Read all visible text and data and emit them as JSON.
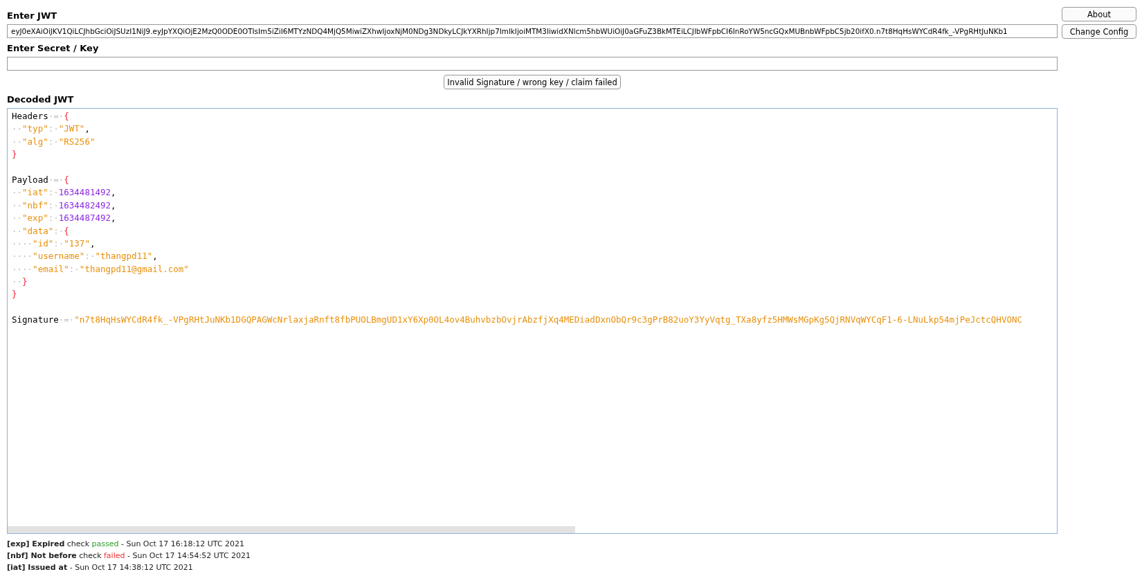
{
  "jwt": {
    "label": "Enter JWT",
    "value": "eyJ0eXAiOiJKV1QiLCJhbGciOiJSUzI1NiJ9.eyJpYXQiOjE2MzQ0ODE0OTIsIm5iZiI6MTYzNDQ4MjQ5MiwiZXhwIjoxNjM0NDg3NDkyLCJkYXRhIjp7ImlkIjoiMTM3IiwidXNlcm5hbWUiOiJ0aGFuZ3BkMTEiLCJlbWFpbCI6InRoYW5ncGQxMUBnbWFpbC5jb20ifX0.n7t8HqHsWYCdR4fk_-VPgRHtJuNKb1"
  },
  "secret": {
    "label": "Enter Secret / Key"
  },
  "verify_button": "Invalid Signature / wrong key / claim failed",
  "side_buttons": [
    "About",
    "Change Config"
  ],
  "decoded": {
    "label": "Decoded JWT",
    "lines": [
      [
        {
          "kind": "plain",
          "text": "Headers"
        },
        {
          "kind": "ws",
          "text": "·=·"
        },
        {
          "kind": "brace",
          "text": "{"
        }
      ],
      [
        {
          "kind": "ws",
          "text": "··"
        },
        {
          "kind": "str",
          "text": "\"typ\""
        },
        {
          "kind": "ws",
          "text": ":·"
        },
        {
          "kind": "str",
          "text": "\"JWT\""
        },
        {
          "kind": "plain",
          "text": ","
        }
      ],
      [
        {
          "kind": "ws",
          "text": "··"
        },
        {
          "kind": "str",
          "text": "\"alg\""
        },
        {
          "kind": "ws",
          "text": ":·"
        },
        {
          "kind": "str",
          "text": "\"RS256\""
        }
      ],
      [
        {
          "kind": "brace",
          "text": "}"
        }
      ],
      [
        {
          "kind": "gap"
        },
        {
          "kind": "plain",
          "text": "Payload"
        },
        {
          "kind": "ws",
          "text": "·=·"
        },
        {
          "kind": "brace",
          "text": "{"
        }
      ],
      [
        {
          "kind": "ws",
          "text": "··"
        },
        {
          "kind": "str",
          "text": "\"iat\""
        },
        {
          "kind": "ws",
          "text": ":·"
        },
        {
          "kind": "num",
          "text": "1634481492"
        },
        {
          "kind": "plain",
          "text": ","
        }
      ],
      [
        {
          "kind": "ws",
          "text": "··"
        },
        {
          "kind": "str",
          "text": "\"nbf\""
        },
        {
          "kind": "ws",
          "text": ":·"
        },
        {
          "kind": "num",
          "text": "1634482492"
        },
        {
          "kind": "plain",
          "text": ","
        }
      ],
      [
        {
          "kind": "ws",
          "text": "··"
        },
        {
          "kind": "str",
          "text": "\"exp\""
        },
        {
          "kind": "ws",
          "text": ":·"
        },
        {
          "kind": "num",
          "text": "1634487492"
        },
        {
          "kind": "plain",
          "text": ","
        }
      ],
      [
        {
          "kind": "ws",
          "text": "··"
        },
        {
          "kind": "str",
          "text": "\"data\""
        },
        {
          "kind": "ws",
          "text": ":·"
        },
        {
          "kind": "brace",
          "text": "{"
        }
      ],
      [
        {
          "kind": "ws",
          "text": "····"
        },
        {
          "kind": "str",
          "text": "\"id\""
        },
        {
          "kind": "ws",
          "text": ":·"
        },
        {
          "kind": "str",
          "text": "\"137\""
        },
        {
          "kind": "plain",
          "text": ","
        }
      ],
      [
        {
          "kind": "ws",
          "text": "····"
        },
        {
          "kind": "str",
          "text": "\"username\""
        },
        {
          "kind": "ws",
          "text": ":·"
        },
        {
          "kind": "str",
          "text": "\"thangpd11\""
        },
        {
          "kind": "plain",
          "text": ","
        }
      ],
      [
        {
          "kind": "ws",
          "text": "····"
        },
        {
          "kind": "str",
          "text": "\"email\""
        },
        {
          "kind": "ws",
          "text": ":·"
        },
        {
          "kind": "str",
          "text": "\"thangpd11@gmail.com\""
        }
      ],
      [
        {
          "kind": "ws",
          "text": "··"
        },
        {
          "kind": "brace",
          "text": "}"
        }
      ],
      [
        {
          "kind": "brace",
          "text": "}"
        }
      ],
      [
        {
          "kind": "gap"
        },
        {
          "kind": "plain",
          "text": "Signature"
        },
        {
          "kind": "ws",
          "text": "·=·"
        },
        {
          "kind": "str",
          "text": "\"n7t8HqHsWYCdR4fk_-VPgRHtJuNKb1DGQPAGWcNrlaxjaRnft8fbPUOLBmgUD1xY6Xp0OL4ov4BuhvbzbOvjrAbzfjXq4MEDiadDxnObQr9c3gPrB82uoY3YyVqtg_TXa8yfz5HMWsMGpKg5QjRNVqWYCqF1-6-LNuLkp54mjPeJctcQHVONC"
        }
      ]
    ]
  },
  "checks": [
    {
      "label": "**[exp] Expired** check",
      "result": "passed",
      "time": "- Sun Oct 17 16:18:12 UTC 2021"
    },
    {
      "label": "**[nbf] Not before** check",
      "result": "failed",
      "time": "- Sun Oct 17 14:54:52 UTC 2021"
    },
    {
      "label": "**[iat] Issued at**",
      "time": "- Sun Oct 17 14:38:12 UTC 2021"
    }
  ]
}
